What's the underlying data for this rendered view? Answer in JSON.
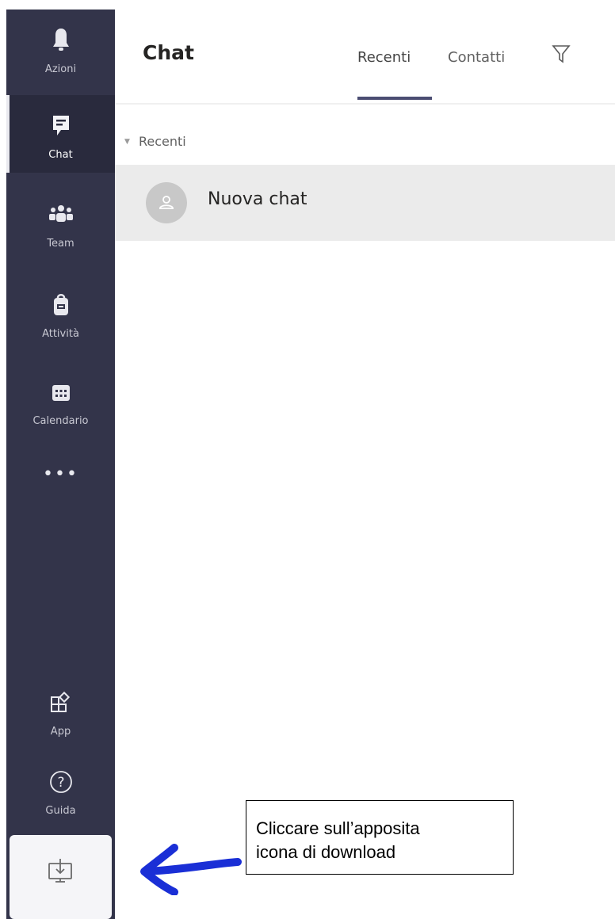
{
  "rail": {
    "items": [
      {
        "label": "Azioni",
        "icon": "bell-icon"
      },
      {
        "label": "Chat",
        "icon": "chat-icon",
        "active": true
      },
      {
        "label": "Team",
        "icon": "teams-icon"
      },
      {
        "label": "Attività",
        "icon": "assignment-bag-icon"
      },
      {
        "label": "Calendario",
        "icon": "calendar-icon"
      },
      {
        "label": "•••",
        "icon": "more-icon"
      },
      {
        "label": "App",
        "icon": "apps-icon"
      },
      {
        "label": "Guida",
        "icon": "help-icon"
      }
    ],
    "download_icon": "download-app-icon"
  },
  "header": {
    "title": "Chat",
    "tabs": [
      {
        "label": "Recenti",
        "selected": true
      },
      {
        "label": "Contatti",
        "selected": false
      }
    ],
    "filter_icon": "filter-icon"
  },
  "list": {
    "section_label": "Recenti",
    "items": [
      {
        "label": "Nuova chat",
        "icon": "avatar-icon"
      }
    ]
  },
  "annotation": {
    "line1": "Cliccare sull’apposita",
    "line2": "icona di download"
  },
  "colors": {
    "rail_bg": "#33344a",
    "rail_active_bg": "#292a3d",
    "accent_underline": "#4b4d72",
    "row_highlight": "#ebebeb",
    "arrow": "#1a2fd6"
  }
}
